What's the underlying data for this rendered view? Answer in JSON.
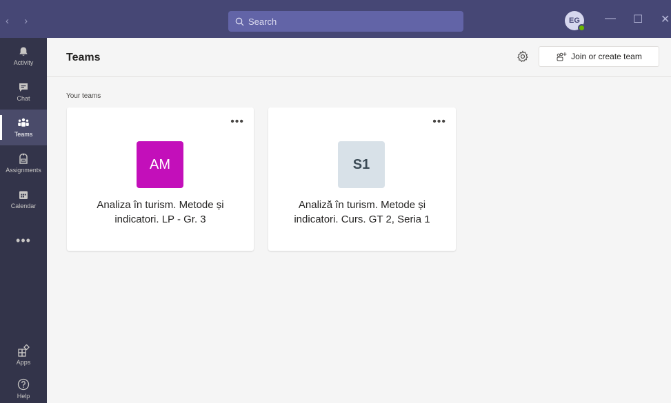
{
  "titlebar": {
    "search_placeholder": "Search",
    "avatar_initials": "EG",
    "back_glyph": "‹",
    "forward_glyph": "›",
    "minimize_glyph": "—",
    "maximize_glyph": "☐",
    "close_glyph": "✕"
  },
  "rail": {
    "items": [
      {
        "label": "Activity",
        "icon": "bell-icon"
      },
      {
        "label": "Chat",
        "icon": "chat-icon"
      },
      {
        "label": "Teams",
        "icon": "teams-icon",
        "active": true
      },
      {
        "label": "Assignments",
        "icon": "assignments-icon"
      },
      {
        "label": "Calendar",
        "icon": "calendar-icon"
      }
    ],
    "more": "•••",
    "apps_label": "Apps",
    "help_label": "Help"
  },
  "header": {
    "title": "Teams",
    "join_label": "Join or create team"
  },
  "main": {
    "section_title": "Your teams",
    "teams": [
      {
        "initials": "AM",
        "name": "Analiza în turism. Metode și indicatori. LP - Gr. 3",
        "tile_color": "#c30fba",
        "text_color": "#ffffff"
      },
      {
        "initials": "S1",
        "name": "Analiză în turism. Metode și indicatori. Curs. GT 2, Seria 1",
        "tile_color": "#d8e1e8",
        "text_color": "#3b4a55"
      }
    ],
    "more_glyph": "•••"
  },
  "colors": {
    "titlebar": "#464775",
    "rail": "#33344a",
    "accent": "#6264a7"
  }
}
